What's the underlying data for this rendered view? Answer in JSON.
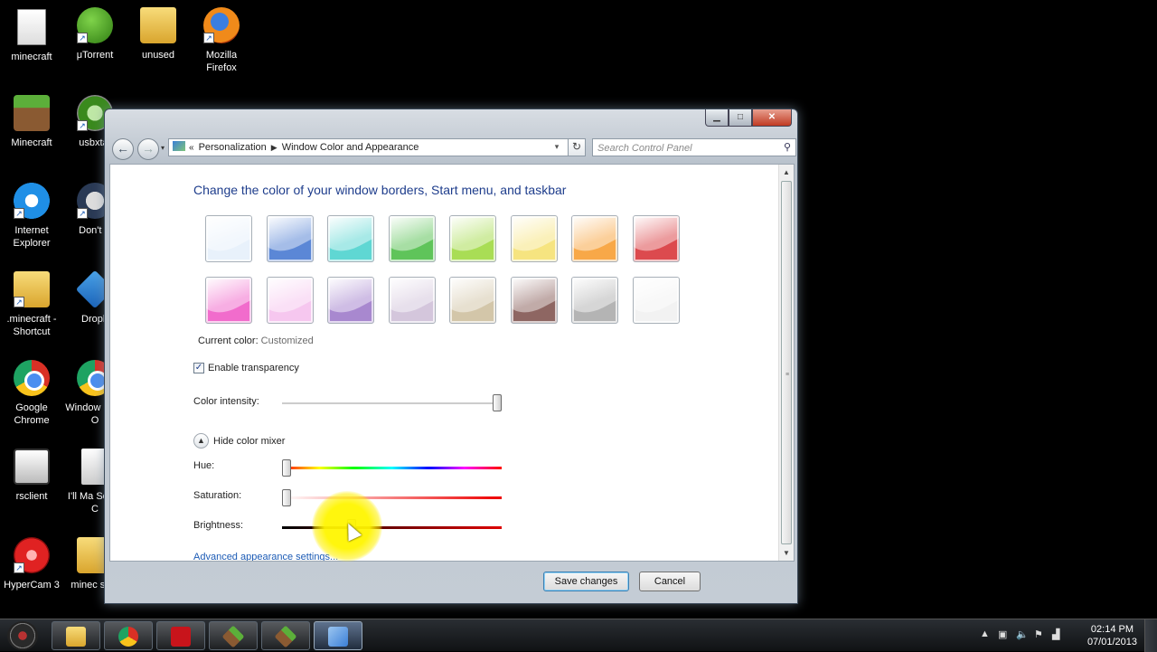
{
  "desktop_icons": [
    {
      "label": "minecraft",
      "icon": "java-doc-icon"
    },
    {
      "label": "μTorrent",
      "icon": "utorrent-icon"
    },
    {
      "label": "unused",
      "icon": "folder-icon"
    },
    {
      "label": "Mozilla Firefox",
      "icon": "firefox-icon"
    },
    {
      "label": "Minecraft",
      "icon": "minecraft-icon"
    },
    {
      "label": "usbxtaf",
      "icon": "xbox-icon"
    },
    {
      "label": "Internet Explorer",
      "icon": "ie-icon"
    },
    {
      "label": "Don't S",
      "icon": "mask-icon"
    },
    {
      "label": ".minecraft - Shortcut",
      "icon": "folder-icon"
    },
    {
      "label": "Dropb",
      "icon": "dropbox-icon"
    },
    {
      "label": "Google Chrome",
      "icon": "chrome-icon"
    },
    {
      "label": "Window Start O",
      "icon": "chrome-icon"
    },
    {
      "label": "rsclient",
      "icon": "film-icon"
    },
    {
      "label": "I'll Ma Some C",
      "icon": "mp3-icon"
    },
    {
      "label": "HyperCam 3",
      "icon": "hypercam-icon"
    },
    {
      "label": "minec serv",
      "icon": "folder-icon"
    }
  ],
  "window": {
    "breadcrumb_root": "Personalization",
    "breadcrumb_current": "Window Color and Appearance",
    "search_placeholder": "Search Control Panel",
    "heading": "Change the color of your window borders, Start menu, and taskbar",
    "swatches": [
      {
        "name": "sky",
        "color": "#e8f1fb"
      },
      {
        "name": "twilight",
        "color": "#5b87d6"
      },
      {
        "name": "sea",
        "color": "#5fd7d3"
      },
      {
        "name": "leaf",
        "color": "#5fc45a"
      },
      {
        "name": "lime",
        "color": "#a9dd55"
      },
      {
        "name": "lemon",
        "color": "#f6e480"
      },
      {
        "name": "tangerine",
        "color": "#f8a848"
      },
      {
        "name": "ruby",
        "color": "#dc4a4e"
      },
      {
        "name": "fuchsia",
        "color": "#f16ccc"
      },
      {
        "name": "blush",
        "color": "#f6c7ef"
      },
      {
        "name": "violet",
        "color": "#a888cf"
      },
      {
        "name": "lavender",
        "color": "#d4c6dc"
      },
      {
        "name": "taupe",
        "color": "#d3c6a9"
      },
      {
        "name": "chocolate",
        "color": "#8e6662"
      },
      {
        "name": "slate",
        "color": "#b4b4b4"
      },
      {
        "name": "frost",
        "color": "#f2f2f2"
      }
    ],
    "current_color_label": "Current color:",
    "current_color_value": "Customized",
    "enable_transparency_label": "Enable transparency",
    "enable_transparency_checked": true,
    "color_intensity_label": "Color intensity:",
    "color_intensity_level": 1.0,
    "mixer_toggle_label": "Hide color mixer",
    "hue_label": "Hue:",
    "hue_level": 0.0,
    "saturation_label": "Saturation:",
    "saturation_level": 0.0,
    "brightness_label": "Brightness:",
    "brightness_level": 0.31,
    "advanced_link": "Advanced appearance settings...",
    "save_label": "Save changes",
    "cancel_label": "Cancel"
  },
  "taskbar": {
    "clock_time": "02:14 PM",
    "clock_date": "07/01/2013",
    "pinned": [
      "explorer",
      "chrome",
      "adobe",
      "minecraft",
      "minecraft-server",
      "control-panel"
    ]
  }
}
